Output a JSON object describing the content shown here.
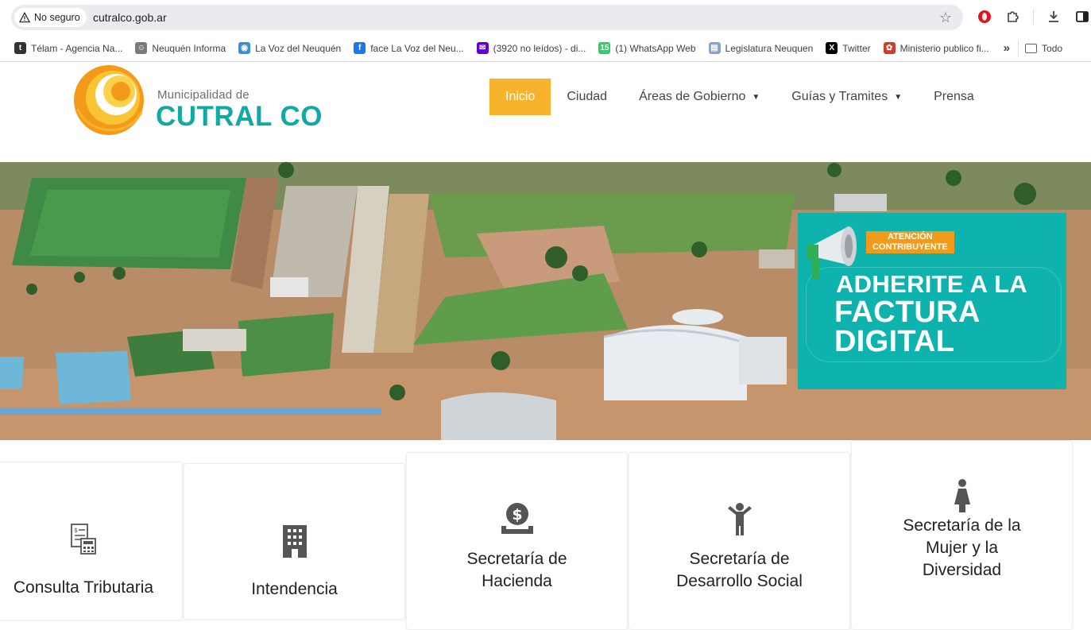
{
  "browser": {
    "security_label": "No seguro",
    "url": "cutralco.gob.ar",
    "star_icon": "star-icon",
    "toolbar_icons": [
      "opera-icon",
      "extensions-icon",
      "download-icon",
      "side-panel-icon"
    ]
  },
  "bookmarks": {
    "items": [
      {
        "label": "Télam - Agencia Na...",
        "icon": "telam-icon",
        "color": "#333333",
        "glyph": "t"
      },
      {
        "label": "Neuquén Informa",
        "icon": "neuquen-icon",
        "color": "#7a7a7a",
        "glyph": "☺"
      },
      {
        "label": "La Voz del Neuquén",
        "icon": "globe-icon",
        "color": "#3a8fd6",
        "glyph": "◉"
      },
      {
        "label": "face La Voz del Neu...",
        "icon": "facebook-icon",
        "color": "#1877f2",
        "glyph": "f"
      },
      {
        "label": "(3920 no leídos) - di...",
        "icon": "mail-icon",
        "color": "#6001d2",
        "glyph": "✉"
      },
      {
        "label": "(1) WhatsApp Web",
        "icon": "whatsapp-icon",
        "color": "#25d366",
        "glyph": "15"
      },
      {
        "label": "Legislatura Neuquen",
        "icon": "document-icon",
        "color": "#8aa4c8",
        "glyph": "▤"
      },
      {
        "label": "Twitter",
        "icon": "x-icon",
        "color": "#000000",
        "glyph": "X"
      },
      {
        "label": "Ministerio publico fi...",
        "icon": "ministerio-icon",
        "color": "#d33c2a",
        "glyph": "✿"
      }
    ],
    "more_label": "»",
    "folder_label": "Todo"
  },
  "site": {
    "logo_small": "Municipalidad de",
    "logo_big": "CUTRAL CO",
    "colors": {
      "orange": "#f7b32b",
      "teal": "#13a9a3"
    },
    "nav": [
      {
        "label": "Inicio",
        "active": true,
        "dropdown": false
      },
      {
        "label": "Ciudad",
        "active": false,
        "dropdown": false
      },
      {
        "label": "Áreas de Gobierno",
        "active": false,
        "dropdown": true
      },
      {
        "label": "Guías y Tramites",
        "active": false,
        "dropdown": true
      },
      {
        "label": "Prensa",
        "active": false,
        "dropdown": false
      }
    ]
  },
  "banner": {
    "tag_line1": "ATENCIÓN",
    "tag_line2": "CONTRIBUYENTE",
    "line1": "ADHERITE A LA",
    "line2": "FACTURA",
    "line3": "DIGITAL"
  },
  "cards": [
    {
      "title_lines": [
        "Consulta Tributaria"
      ],
      "icon": "invoice-calculator-icon"
    },
    {
      "title_lines": [
        "Intendencia"
      ],
      "icon": "building-icon"
    },
    {
      "title_lines": [
        "Secretaría de",
        "Hacienda"
      ],
      "icon": "money-bag-icon"
    },
    {
      "title_lines": [
        "Secretaría de",
        "Desarrollo Social"
      ],
      "icon": "child-icon"
    },
    {
      "title_lines": [
        "Secretaría de la",
        "Mujer y la",
        "Diversidad"
      ],
      "icon": "woman-icon"
    }
  ]
}
